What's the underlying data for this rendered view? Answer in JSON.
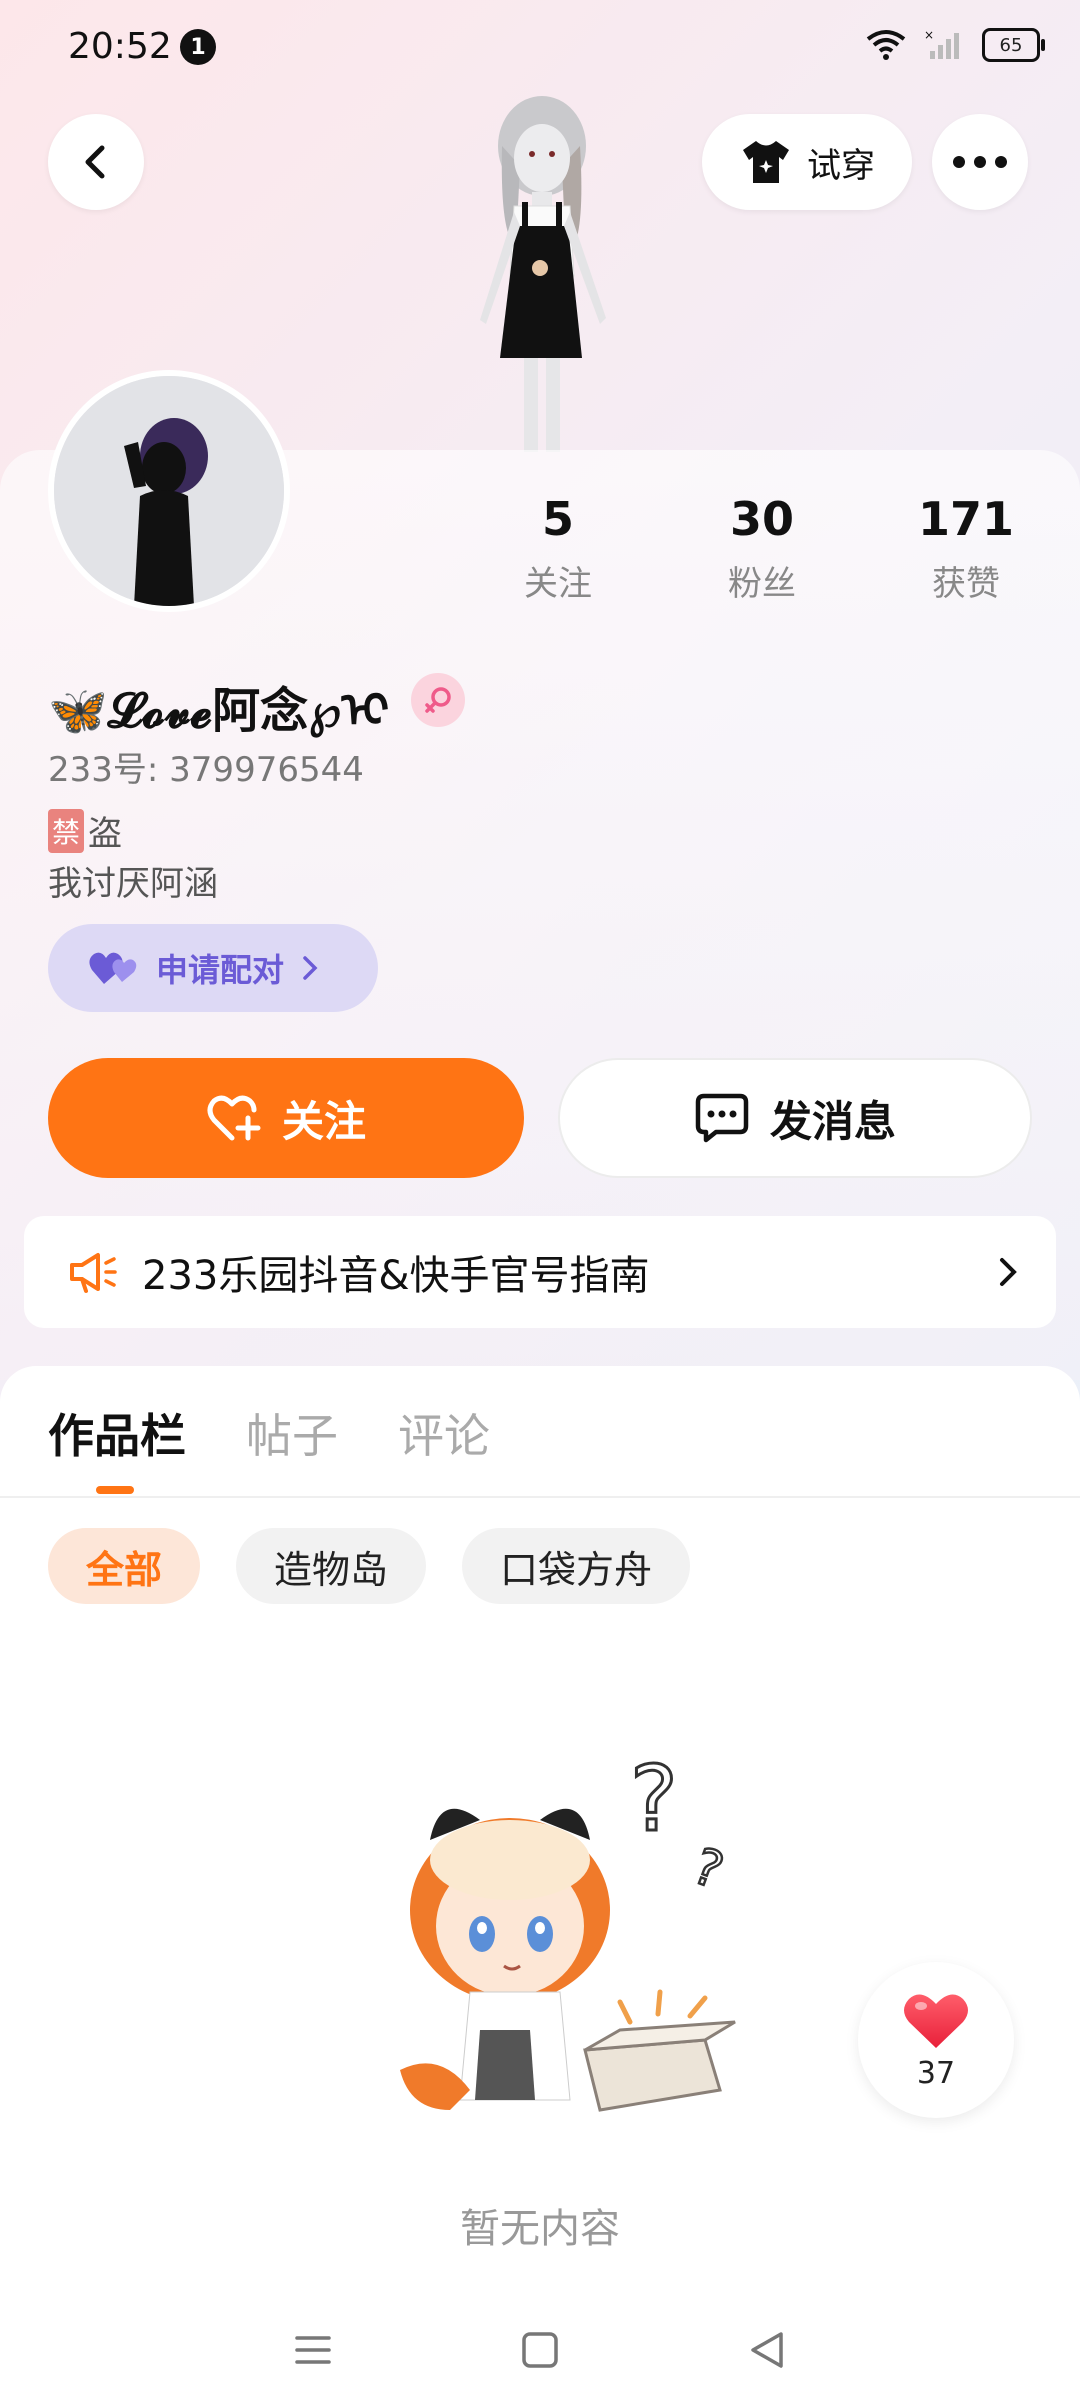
{
  "status_bar": {
    "time": "20:52",
    "notification_count": "1",
    "battery": "65"
  },
  "header": {
    "try_on_label": "试穿"
  },
  "profile": {
    "stats": [
      {
        "value": "5",
        "label": "关注"
      },
      {
        "value": "30",
        "label": "粉丝"
      },
      {
        "value": "171",
        "label": "获赞"
      }
    ],
    "nickname": "🦋𝓛𝓸𝓿𝓮阿念℘ᢈ",
    "uid_label": "233号:",
    "uid_value": "379976544",
    "bio_tag": "禁",
    "bio_line1": "盗",
    "bio_line2": "我讨厌阿涵",
    "pair_button": "申请配对"
  },
  "actions": {
    "follow": "关注",
    "message": "发消息"
  },
  "notice": {
    "text": "233乐园抖音&快手官号指南"
  },
  "tabs": [
    {
      "label": "作品栏",
      "active": true
    },
    {
      "label": "帖子",
      "active": false
    },
    {
      "label": "评论",
      "active": false
    }
  ],
  "filters": [
    {
      "label": "全部",
      "active": true
    },
    {
      "label": "造物岛",
      "active": false
    },
    {
      "label": "口袋方舟",
      "active": false
    }
  ],
  "empty_state": {
    "text": "暂无内容"
  },
  "like_fab": {
    "count": "37"
  },
  "colors": {
    "accent": "#ff7414",
    "pair_purple": "#6b5bd6"
  }
}
